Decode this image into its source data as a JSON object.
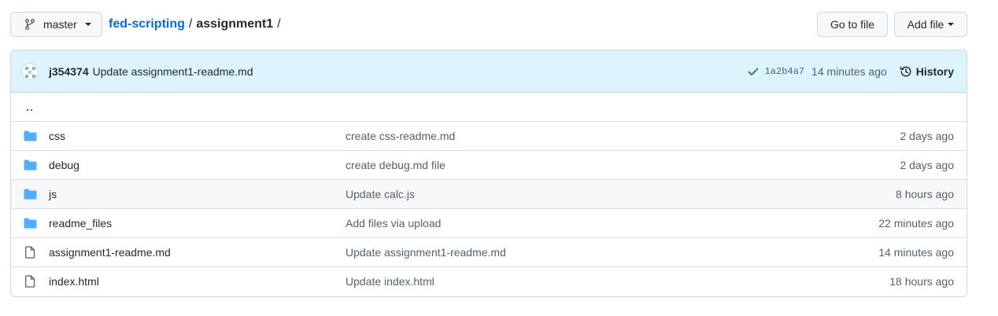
{
  "toolbar": {
    "branch": "master",
    "repo": "fed-scripting",
    "separator": "/",
    "folder": "assignment1",
    "trailing_separator": "/",
    "goto_file": "Go to file",
    "add_file": "Add file"
  },
  "commit": {
    "author": "j354374",
    "message": "Update assignment1-readme.md",
    "sha": "1a2b4a7",
    "time": "14 minutes ago",
    "history_label": "History",
    "status": "success"
  },
  "files": {
    "parent_dir": "..",
    "rows": [
      {
        "type": "dir",
        "icon": "folder-icon",
        "name": "css",
        "message": "create css-readme.md",
        "age": "2 days ago"
      },
      {
        "type": "dir",
        "icon": "folder-icon",
        "name": "debug",
        "message": "create debug.md file",
        "age": "2 days ago"
      },
      {
        "type": "dir",
        "icon": "folder-icon",
        "name": "js",
        "message": "Update calc.js",
        "age": "8 hours ago"
      },
      {
        "type": "dir",
        "icon": "folder-icon",
        "name": "readme_files",
        "message": "Add files via upload",
        "age": "22 minutes ago"
      },
      {
        "type": "file",
        "icon": "file-icon",
        "name": "assignment1-readme.md",
        "message": "Update assignment1-readme.md",
        "age": "14 minutes ago"
      },
      {
        "type": "file",
        "icon": "file-icon",
        "name": "index.html",
        "message": "Update index.html",
        "age": "18 hours ago"
      }
    ]
  },
  "colors": {
    "link": "#0969da",
    "folder": "#54aeff",
    "commit_bar": "#ddf4ff",
    "success": "#1a7f37",
    "hover_row": "#f6f8fa"
  }
}
